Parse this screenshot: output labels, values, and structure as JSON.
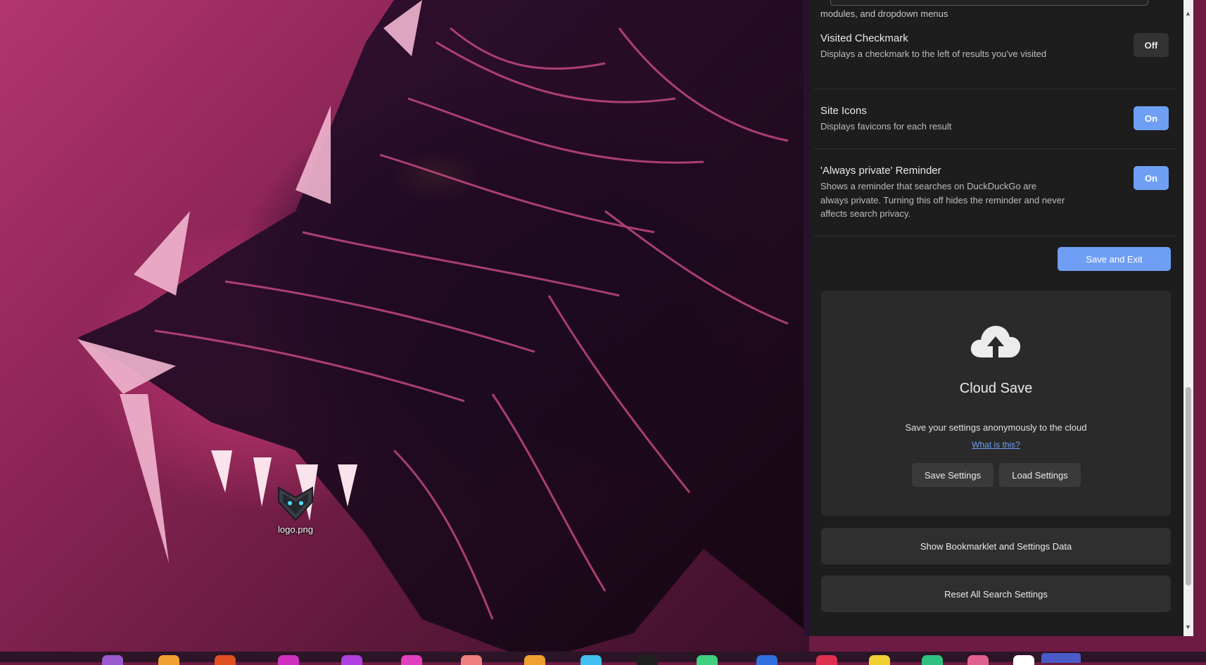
{
  "desktop": {
    "icons": [
      {
        "label": "logo.png",
        "icon": "shield-logo-icon"
      }
    ]
  },
  "settings": {
    "partial_text": "modules, and dropdown menus",
    "rows": [
      {
        "title": "Visited Checkmark",
        "desc": "Displays a checkmark to the left of results you've visited",
        "toggle": "Off"
      },
      {
        "title": "Site Icons",
        "desc": "Displays favicons for each result",
        "toggle": "On"
      },
      {
        "title": "'Always private' Reminder",
        "desc": "Shows a reminder that searches on DuckDuckGo are always private. Turning this off hides the reminder and never affects search privacy.",
        "toggle": "On"
      }
    ],
    "save_exit_label": "Save and Exit",
    "cloud": {
      "icon": "cloud-upload-icon",
      "title": "Cloud Save",
      "desc": "Save your settings anonymously to the cloud",
      "link": "What is this?",
      "save_label": "Save Settings",
      "load_label": "Load Settings"
    },
    "bookmarklet_label": "Show Bookmarklet and Settings Data",
    "reset_label": "Reset All Search Settings"
  },
  "colors": {
    "accent": "#6f9ff5",
    "panel_bg": "#1d1d1d",
    "card_bg": "#2a2a2a"
  },
  "taskbar": {
    "icon_colors": [
      "#9b59d0",
      "#f0a030",
      "#e05020",
      "#d030c0",
      "#b040e0",
      "#e040c0",
      "#f08080",
      "#f0a030",
      "#40c0f0",
      "#202020",
      "#40d080",
      "#3070e0",
      "#e03050",
      "#f0d030",
      "#30c080",
      "#e06090",
      "#ffffff",
      "#4a5ac8"
    ]
  }
}
